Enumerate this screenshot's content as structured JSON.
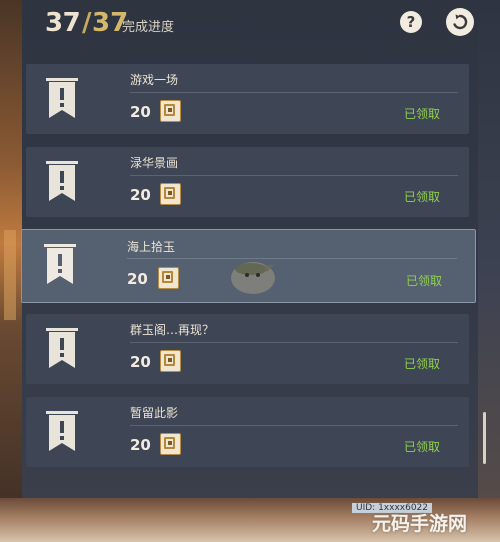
{
  "header": {
    "progress_current": "37",
    "progress_separator": "/",
    "progress_total": "37",
    "progress_label": "完成进度",
    "help_glyph": "?"
  },
  "achievements": [
    {
      "title": "游戏一场",
      "reward_amount": "20",
      "status": "已领取",
      "icon": "banner-exclamation-icon"
    },
    {
      "title": "渌华景画",
      "reward_amount": "20",
      "status": "已领取",
      "icon": "banner-exclamation-icon"
    },
    {
      "title": "海上拾玉",
      "reward_amount": "20",
      "status": "已领取",
      "icon": "banner-exclamation-icon"
    },
    {
      "title": "群玉阁…再现？",
      "reward_amount": "20",
      "status": "已领取",
      "icon": "banner-exclamation-icon"
    },
    {
      "title": "暂留此影",
      "reward_amount": "20",
      "status": "已领取",
      "icon": "banner-exclamation-icon"
    }
  ],
  "colors": {
    "panel": "#333947",
    "card": "#3e4554",
    "card_highlight": "#556070",
    "status_green": "#8fd14f",
    "gold": "#d4b76a"
  },
  "watermark": "元码手游网",
  "bottom_tag": "UID: 1xxxx6022"
}
